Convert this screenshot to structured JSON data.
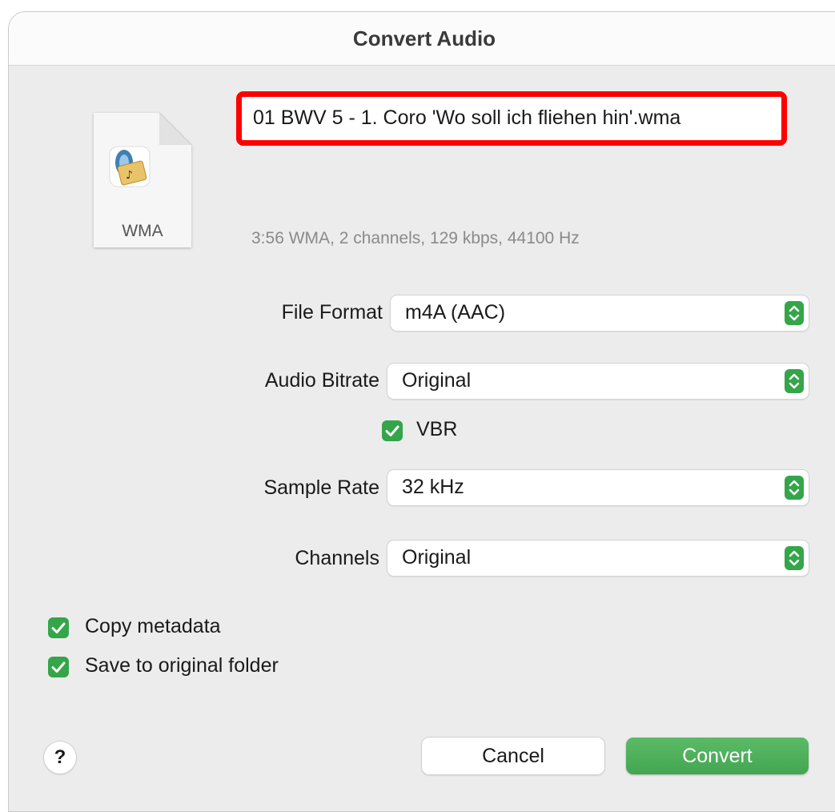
{
  "window": {
    "title": "Convert Audio"
  },
  "file": {
    "name": "01 BWV 5 - 1. Coro 'Wo soll ich fliehen hin'.wma",
    "icon_label": "WMA",
    "icon": "wma-audio-file-icon",
    "info": "3:56 WMA, 2 channels, 129 kbps, 44100 Hz"
  },
  "settings": {
    "file_format": {
      "label": "File Format",
      "value": "m4A (AAC)"
    },
    "audio_bitrate": {
      "label": "Audio Bitrate",
      "value": "Original"
    },
    "vbr": {
      "label": "VBR",
      "checked": true
    },
    "sample_rate": {
      "label": "Sample Rate",
      "value": "32 kHz"
    },
    "channels": {
      "label": "Channels",
      "value": "Original"
    }
  },
  "options": {
    "copy_metadata": {
      "label": "Copy metadata",
      "checked": true
    },
    "save_to_original_folder": {
      "label": "Save to original folder",
      "checked": true
    }
  },
  "buttons": {
    "help": "?",
    "cancel": "Cancel",
    "convert": "Convert"
  },
  "colors": {
    "accent": "#35a54a",
    "highlight_border": "#ff0000"
  }
}
